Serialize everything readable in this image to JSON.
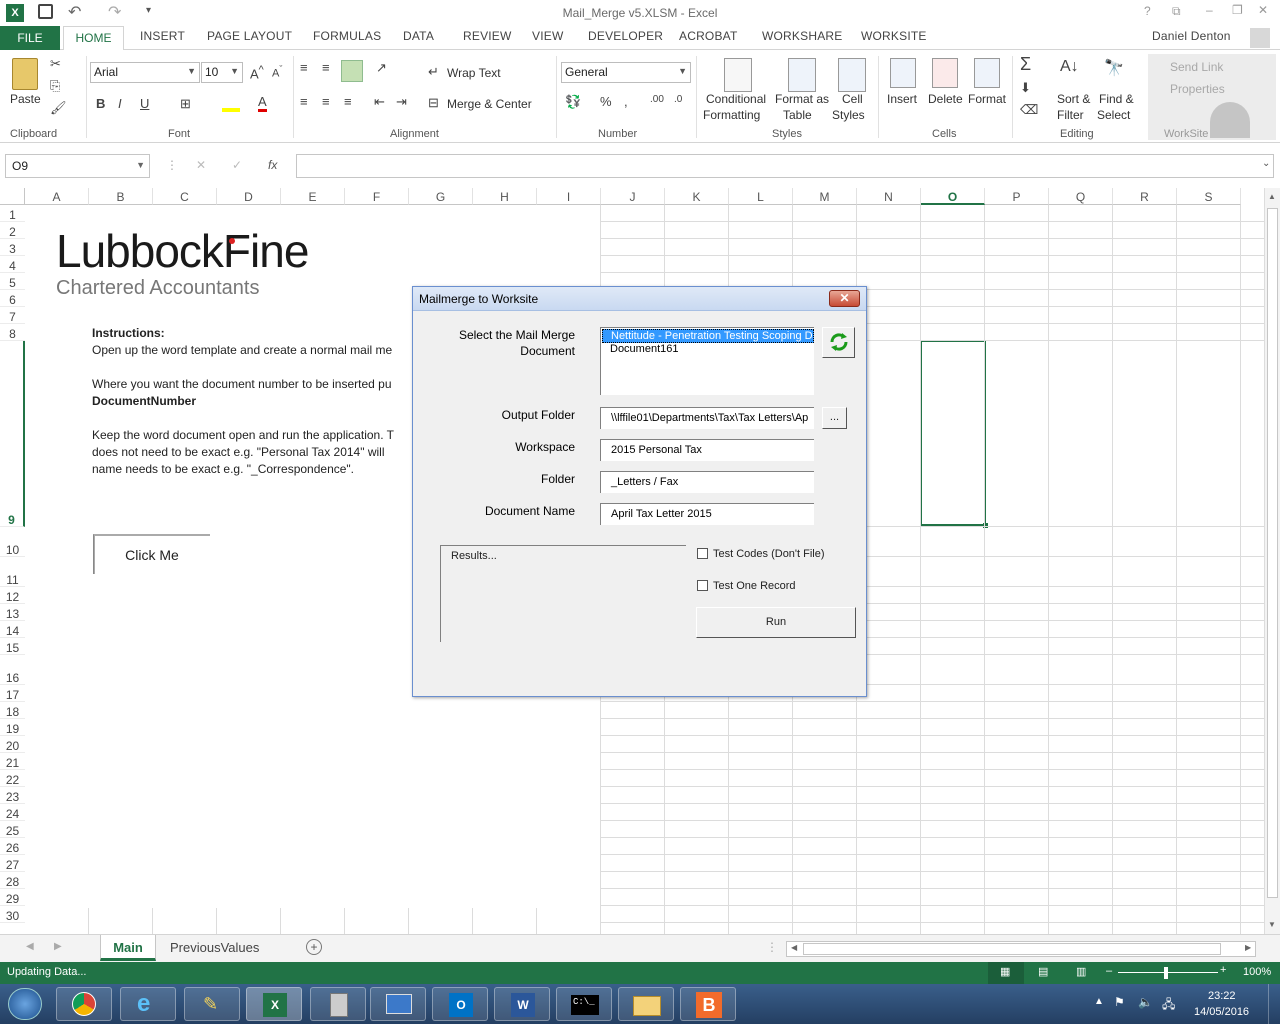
{
  "app": {
    "title": "Mail_Merge v5.XLSM - Excel",
    "user": "Daniel Denton"
  },
  "ribbon_tabs": [
    "FILE",
    "HOME",
    "INSERT",
    "PAGE LAYOUT",
    "FORMULAS",
    "DATA",
    "REVIEW",
    "VIEW",
    "DEVELOPER",
    "ACROBAT",
    "WORKSHARE",
    "WORKSITE"
  ],
  "ribbon": {
    "paste": "Paste",
    "font_name": "Arial",
    "font_size": "10",
    "wrap_text": "Wrap Text",
    "merge_center": "Merge & Center",
    "number_format": "General",
    "cond_format_1": "Conditional",
    "cond_format_2": "Formatting",
    "format_table_1": "Format as",
    "format_table_2": "Table",
    "cell_styles_1": "Cell",
    "cell_styles_2": "Styles",
    "insert": "Insert",
    "delete": "Delete",
    "format": "Format",
    "sort_filter_1": "Sort &",
    "sort_filter_2": "Filter",
    "find_select_1": "Find &",
    "find_select_2": "Select",
    "send_link": "Send Link",
    "properties": "Properties",
    "groups": {
      "clipboard": "Clipboard",
      "font": "Font",
      "alignment": "Alignment",
      "number": "Number",
      "styles": "Styles",
      "cells": "Cells",
      "editing": "Editing",
      "worksite": "WorkSite"
    }
  },
  "formula_bar": {
    "name_box": "O9",
    "fx": "fx"
  },
  "columns": [
    "A",
    "B",
    "C",
    "D",
    "E",
    "F",
    "G",
    "H",
    "I",
    "J",
    "K",
    "L",
    "M",
    "N",
    "O",
    "P",
    "Q",
    "R",
    "S"
  ],
  "rows": [
    "1",
    "2",
    "3",
    "4",
    "5",
    "6",
    "7",
    "8",
    "9",
    "10",
    "11",
    "12",
    "13",
    "14",
    "15",
    "16",
    "17",
    "18",
    "19",
    "20",
    "21",
    "22",
    "23",
    "24",
    "25",
    "26",
    "27",
    "28",
    "29",
    "30"
  ],
  "sheet_content": {
    "logo_name": "LubbockFine",
    "logo_sub": "Chartered Accountants",
    "instructions_title": "Instructions:",
    "line1": "Open up the word template and create a normal mail me",
    "line2": "Where you want the document number to be inserted pu",
    "line3": "DocumentNumber",
    "line4": "Keep the word document open and run the application. T",
    "line5": "does not need to be exact e.g. \"Personal Tax 2014\" will",
    "line6": "name needs to be exact e.g. \"_Correspondence\".",
    "button": "Click Me"
  },
  "dialog": {
    "title": "Mailmerge to Worksite",
    "select_label_1": "Select the Mail Merge",
    "select_label_2": "Document",
    "documents": [
      "Nettitude - Penetration Testing Scoping Do",
      "Document161"
    ],
    "output_label": "Output Folder",
    "output_value": "\\\\lffile01\\Departments\\Tax\\Tax Letters\\Ap",
    "browse": "...",
    "workspace_label": "Workspace",
    "workspace_value": "2015 Personal Tax",
    "folder_label": "Folder",
    "folder_value": "_Letters / Fax",
    "docname_label": "Document Name",
    "docname_value": "April Tax Letter 2015",
    "results": "Results...",
    "test_codes": "Test Codes (Don't File)",
    "test_one": "Test One Record",
    "run": "Run"
  },
  "sheet_tabs": [
    "Main",
    "PreviousValues"
  ],
  "status": {
    "text": "Updating Data...",
    "zoom": "100%"
  },
  "taskbar": {
    "time": "23:22",
    "date": "14/05/2016"
  },
  "colors": {
    "excel_green": "#217346",
    "selection": "#217346"
  }
}
